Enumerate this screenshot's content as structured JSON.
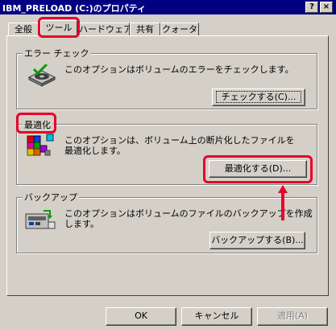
{
  "window": {
    "title": "IBM_PRELOAD (C:)のプロパティ",
    "help_btn": "?",
    "close_btn": "×"
  },
  "tabs": [
    {
      "label": "全般"
    },
    {
      "label": "ツール"
    },
    {
      "label": "ハードウェア"
    },
    {
      "label": "共有"
    },
    {
      "label": "クォータ"
    }
  ],
  "error_check": {
    "title": "エラー チェック",
    "description": "このオプションはボリュームのエラーをチェックします。",
    "button": "チェックする(C)..."
  },
  "defrag": {
    "title": "最適化",
    "description_line1": "このオプションは、ボリューム上の断片化したファイルを",
    "description_line2": "最適化します。",
    "button": "最適化する(D)..."
  },
  "backup": {
    "title": "バックアップ",
    "description_line1": "このオプションはボリュームのファイルのバックアップを作成",
    "description_line2": "します。",
    "button": "バックアップする(B)..."
  },
  "footer": {
    "ok": "OK",
    "cancel": "キャンセル",
    "apply": "適用(A)"
  },
  "highlight_color": "#e8002a"
}
